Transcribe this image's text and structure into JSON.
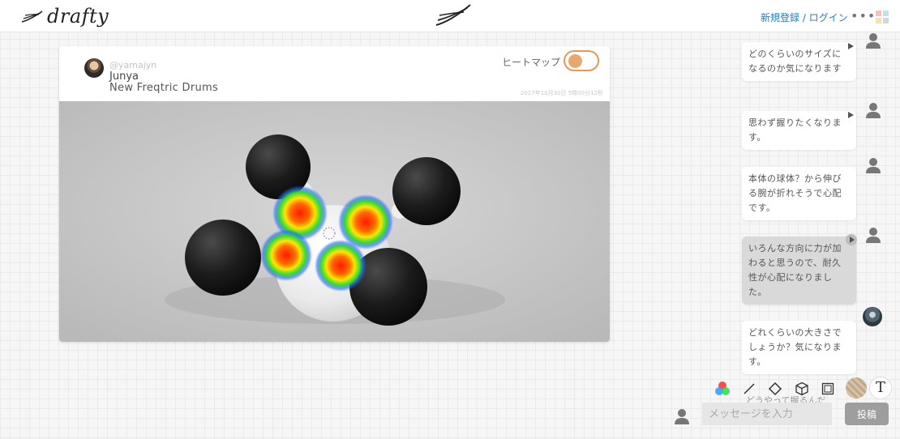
{
  "header": {
    "logo_text": "drafty",
    "auth_link": "新規登録 / ログイン",
    "more_glyph": "•••"
  },
  "post": {
    "handle": "@yamajyn",
    "author_name": "Junya",
    "title": "New Freqtric Drums",
    "date": "2017年10月30日 5時00分12秒",
    "heatmap_label": "ヒートマップ",
    "heatmap_on": true,
    "image_description": "white device with four black spherical pads and heatmap hotspots"
  },
  "comments": [
    {
      "text": "どのくらいのサイズになるのか気になります",
      "avatar": "user-icon",
      "selected": false
    },
    {
      "text": "思わず握りたくなります。",
      "avatar": "user-icon",
      "selected": false
    },
    {
      "text": "本体の球体？から伸びる腕が折れそうで心配です。",
      "avatar": "user-icon",
      "selected": false
    },
    {
      "text": "いろんな方向に力が加わると思うので、耐久性が心配になりました。",
      "avatar": "user-icon",
      "selected": true
    },
    {
      "text": "どれくらいの大きさでしょうか？気になります。",
      "avatar": "photo",
      "selected": false
    },
    {
      "text": "どうやって握るんだ",
      "avatar": "photo",
      "selected": false
    }
  ],
  "tools": [
    "color-wheel",
    "line",
    "diamond",
    "cube",
    "frame",
    "texture",
    "text"
  ],
  "tool_text_glyph": "T",
  "composer": {
    "placeholder": "メッセージを入力",
    "submit_label": "投稿"
  },
  "colors": {
    "link": "#2b7db5",
    "toggle": "#e39a55",
    "selected_comment": "#d9d9d9",
    "post_button": "#9e9e9e"
  }
}
